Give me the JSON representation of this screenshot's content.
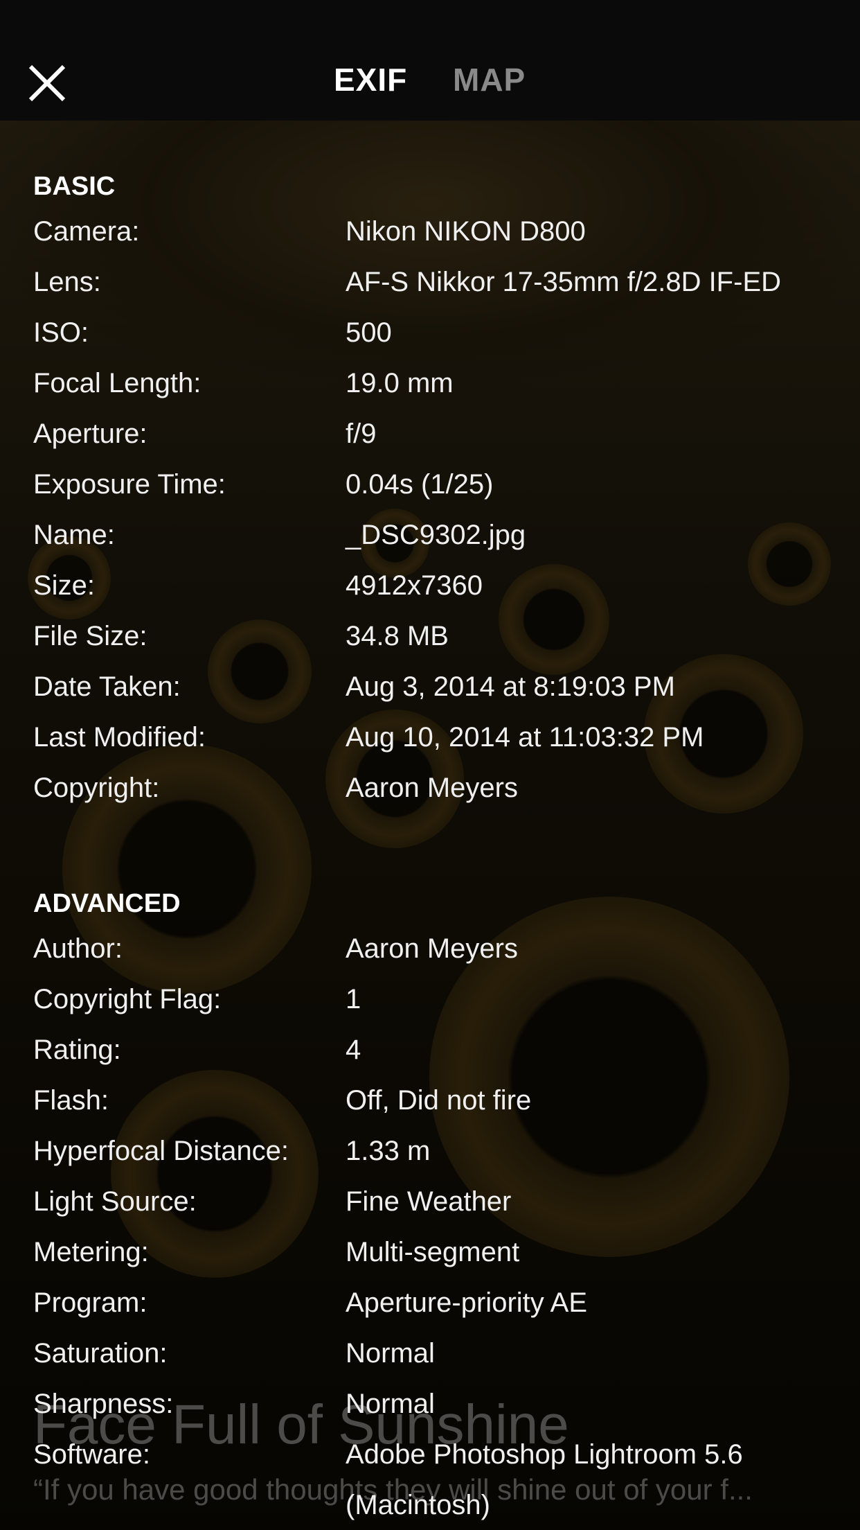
{
  "header": {
    "tabs": [
      {
        "label": "EXIF",
        "active": true
      },
      {
        "label": "MAP",
        "active": false
      }
    ],
    "close_icon": "close-icon"
  },
  "basic": {
    "title": "BASIC",
    "rows": [
      {
        "label": "Camera:",
        "value": "Nikon NIKON D800"
      },
      {
        "label": "Lens:",
        "value": "AF-S Nikkor 17-35mm f/2.8D IF-ED"
      },
      {
        "label": "ISO:",
        "value": "500"
      },
      {
        "label": "Focal Length:",
        "value": "19.0 mm"
      },
      {
        "label": "Aperture:",
        "value": "f/9"
      },
      {
        "label": "Exposure Time:",
        "value": "0.04s (1/25)"
      },
      {
        "label": "Name:",
        "value": "_DSC9302.jpg"
      },
      {
        "label": "Size:",
        "value": "4912x7360"
      },
      {
        "label": "File Size:",
        "value": "34.8 MB"
      },
      {
        "label": "Date Taken:",
        "value": "Aug 3, 2014 at 8:19:03 PM"
      },
      {
        "label": "Last Modified:",
        "value": "Aug 10, 2014 at 11:03:32 PM"
      },
      {
        "label": "Copyright:",
        "value": "Aaron Meyers"
      }
    ]
  },
  "advanced": {
    "title": "ADVANCED",
    "rows": [
      {
        "label": "Author:",
        "value": "Aaron Meyers"
      },
      {
        "label": "Copyright Flag:",
        "value": "1"
      },
      {
        "label": "Rating:",
        "value": "4"
      },
      {
        "label": "Flash:",
        "value": "Off, Did not fire"
      },
      {
        "label": "Hyperfocal Distance:",
        "value": "1.33 m"
      },
      {
        "label": "Light Source:",
        "value": "Fine Weather"
      },
      {
        "label": "Metering:",
        "value": "Multi-segment"
      },
      {
        "label": "Program:",
        "value": "Aperture-priority AE"
      },
      {
        "label": "Saturation:",
        "value": "Normal"
      },
      {
        "label": "Sharpness:",
        "value": "Normal"
      },
      {
        "label": "Software:",
        "value": "Adobe Photoshop Lightroom 5.6 (Macintosh)"
      }
    ]
  },
  "photo": {
    "title": "Face Full of Sunshine",
    "quote": "“If you have good thoughts they will shine out of your f..."
  },
  "colors": {
    "background": "#000000",
    "tab_active": "#ffffff",
    "tab_inactive": "#8a8a8a"
  }
}
